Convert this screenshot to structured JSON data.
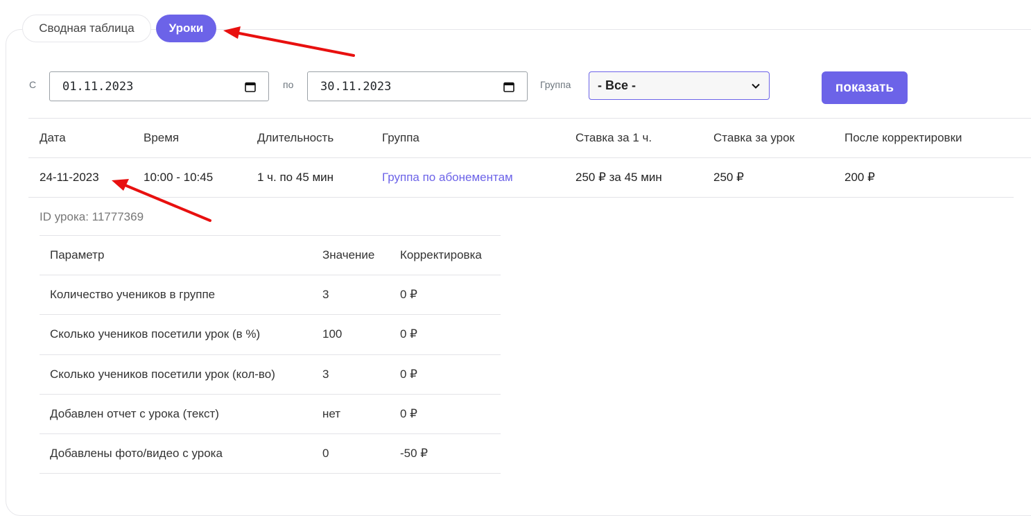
{
  "tabs": {
    "summary": "Сводная таблица",
    "lessons": "Уроки"
  },
  "filters": {
    "from_label": "С",
    "from_value": "01.11.2023",
    "to_label": "по",
    "to_value": "30.11.2023",
    "group_label": "Группа",
    "group_selected": "- Все -",
    "show_button": "показать"
  },
  "lessons_table": {
    "headers": [
      "Дата",
      "Время",
      "Длительность",
      "Группа",
      "Ставка за 1 ч.",
      "Ставка за урок",
      "После корректировки"
    ],
    "rows": [
      {
        "date": "24-11-2023",
        "time": "10:00 - 10:45",
        "duration": "1 ч. по 45 мин",
        "group": "Группа по абонементам",
        "hour_rate": "250 ₽ за 45 мин",
        "lesson_rate": "250 ₽",
        "after_correction": "200 ₽"
      }
    ]
  },
  "lesson_details": {
    "id_text": "ID урока: 11777369",
    "headers": [
      "Параметр",
      "Значение",
      "Корректировка"
    ],
    "rows": [
      {
        "param": "Количество учеников в группе",
        "value": "3",
        "correction": "0 ₽"
      },
      {
        "param": "Сколько учеников посетили урок (в %)",
        "value": "100",
        "correction": "0 ₽"
      },
      {
        "param": "Сколько учеников посетили урок (кол-во)",
        "value": "3",
        "correction": "0 ₽"
      },
      {
        "param": "Добавлен отчет с урока (текст)",
        "value": "нет",
        "correction": "0 ₽"
      },
      {
        "param": "Добавлены фото/видео с урока",
        "value": "0",
        "correction": "-50 ₽"
      }
    ]
  },
  "colors": {
    "accent": "#6c63e8",
    "annotation_arrow": "#e8100f"
  }
}
